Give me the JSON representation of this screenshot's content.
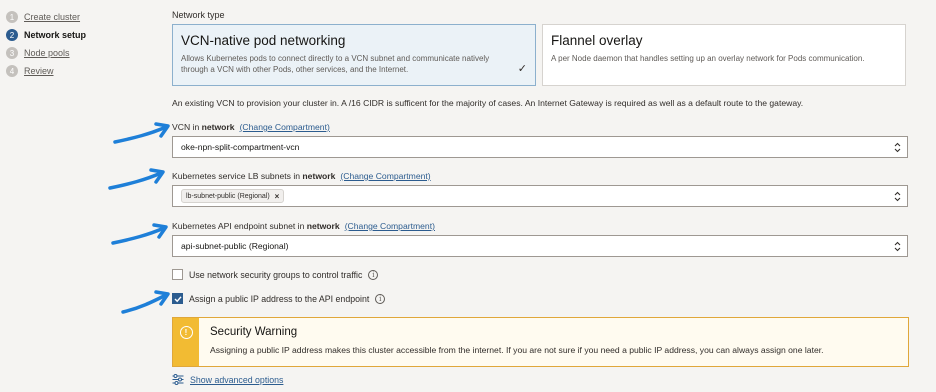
{
  "steps": [
    {
      "num": "1",
      "label": "Create cluster"
    },
    {
      "num": "2",
      "label": "Network setup"
    },
    {
      "num": "3",
      "label": "Node pools"
    },
    {
      "num": "4",
      "label": "Review"
    }
  ],
  "network_type": {
    "label": "Network type",
    "options": [
      {
        "title": "VCN-native pod networking",
        "desc": "Allows Kubernetes pods to connect directly to a VCN subnet and communicate natively through a VCN with other Pods, other services, and the Internet.",
        "selected": true
      },
      {
        "title": "Flannel overlay",
        "desc": "A per Node daemon that handles setting up an overlay network for Pods communication.",
        "selected": false
      }
    ]
  },
  "info_text": "An existing VCN to provision your cluster in. A /16 CIDR is sufficent for the majority of cases. An Internet Gateway is required as well as a default route to the gateway.",
  "vcn": {
    "label_prefix": "VCN in ",
    "compartment": "network",
    "change_link": "(Change Compartment)",
    "value": "oke-npn-split-compartment-vcn"
  },
  "lb_subnets": {
    "label_prefix": "Kubernetes service LB subnets in ",
    "compartment": "network",
    "change_link": "(Change Compartment)",
    "chip": "lb-subnet-public (Regional)",
    "chip_remove": "×"
  },
  "api_subnet": {
    "label_prefix": "Kubernetes API endpoint subnet in ",
    "compartment": "network",
    "change_link": "(Change Compartment)",
    "value": "api-subnet-public (Regional)"
  },
  "nsg_checkbox": {
    "label": "Use network security groups to control traffic",
    "checked": false
  },
  "public_ip_checkbox": {
    "label": "Assign a public IP address to the API endpoint",
    "checked": true
  },
  "warning": {
    "title": "Security Warning",
    "text": "Assigning a public IP address makes this cluster accessible from the internet. If you are not sure if you need a public IP address, you can always assign one later."
  },
  "advanced_link": "Show advanced options",
  "colors": {
    "accent": "#2c5c8f",
    "arrow": "#1e7fd8",
    "warning": "#f2bb33",
    "selected_card": "#ebf2f7"
  }
}
